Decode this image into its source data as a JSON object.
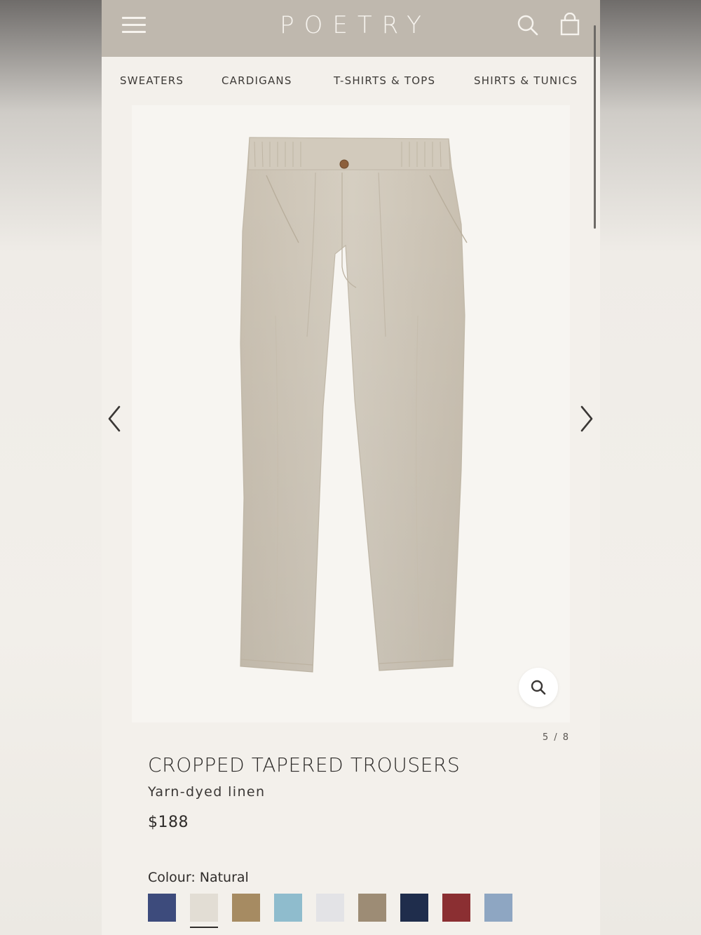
{
  "header": {
    "brand": "POETRY",
    "menu_icon": "hamburger-menu-icon",
    "search_icon": "search-icon",
    "bag_icon": "shopping-bag-icon"
  },
  "category_nav": {
    "items": [
      {
        "label": "SWEATERS"
      },
      {
        "label": "CARDIGANS"
      },
      {
        "label": "T-SHIRTS & TOPS"
      },
      {
        "label": "SHIRTS & TUNICS"
      }
    ]
  },
  "gallery": {
    "counter": "5 / 8",
    "prev_icon": "chevron-left-icon",
    "next_icon": "chevron-right-icon",
    "zoom_icon": "magnifier-icon"
  },
  "product": {
    "title": "CROPPED TAPERED TROUSERS",
    "material": "Yarn-dyed linen",
    "price": "$188",
    "colour_label": "Colour: Natural",
    "selected_colour_index": 1,
    "swatches": [
      {
        "color": "#3d4b7c"
      },
      {
        "color": "#e2ddd4"
      },
      {
        "color": "#a68b62"
      },
      {
        "color": "#8fbccd"
      },
      {
        "color": "#e3e3e6"
      },
      {
        "color": "#9d8c75"
      },
      {
        "color": "#1f2d4c"
      },
      {
        "color": "#8b2f32"
      },
      {
        "color": "#8ea6c2"
      }
    ]
  },
  "colors": {
    "header_bg": "#bfb8ae",
    "page_bg": "#f3f0eb",
    "trouser_fabric": "#d3cbbd"
  }
}
